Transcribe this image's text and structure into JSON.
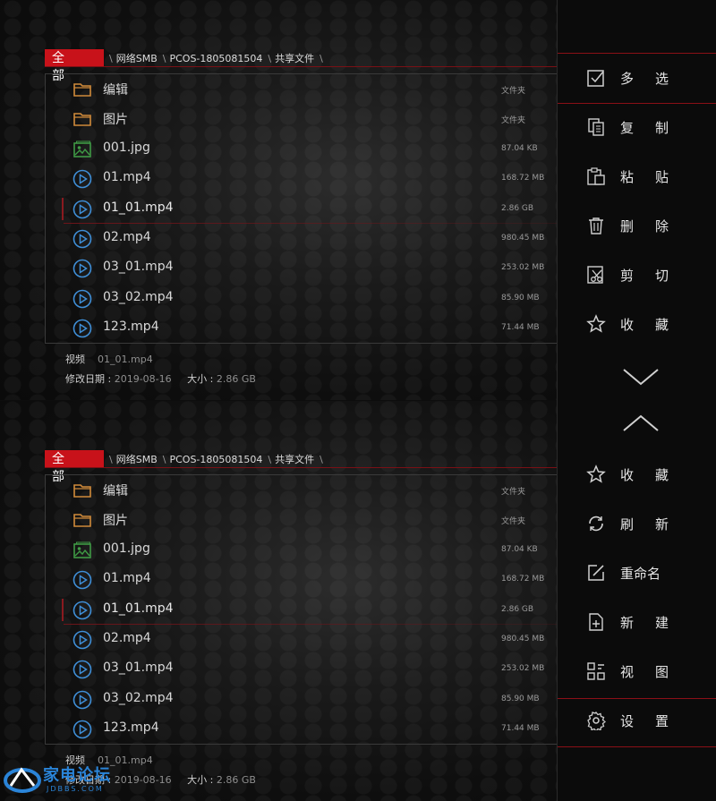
{
  "breadcrumb": {
    "root": "全部",
    "items": [
      "网络SMB",
      "PCOS-1805081504",
      "共享文件"
    ]
  },
  "files": [
    {
      "name": "编辑",
      "size": "文件夹",
      "icon": "folder-icon"
    },
    {
      "name": "图片",
      "size": "文件夹",
      "icon": "folder-icon"
    },
    {
      "name": "001.jpg",
      "size": "87.04 KB",
      "icon": "image-icon"
    },
    {
      "name": "01.mp4",
      "size": "168.72 MB",
      "icon": "play-icon"
    },
    {
      "name": "01_01.mp4",
      "size": "2.86 GB",
      "icon": "play-icon",
      "selected": true
    },
    {
      "name": "02.mp4",
      "size": "980.45 MB",
      "icon": "play-icon"
    },
    {
      "name": "03_01.mp4",
      "size": "253.02 MB",
      "icon": "play-icon"
    },
    {
      "name": "03_02.mp4",
      "size": "85.90 MB",
      "icon": "play-icon"
    },
    {
      "name": "123.mp4",
      "size": "71.44 MB",
      "icon": "play-icon"
    }
  ],
  "info": {
    "type_label": "视频",
    "type_value": "01_01.mp4",
    "date_label": "修改日期 :",
    "date_value": "2019-08-16",
    "size_label": "大小 :",
    "size_value": "2.86 GB"
  },
  "menu_top": [
    {
      "label": "多选",
      "icon": "checkbox-icon"
    },
    {
      "label": "复制",
      "icon": "copy-icon"
    },
    {
      "label": "粘贴",
      "icon": "paste-icon"
    },
    {
      "label": "删除",
      "icon": "trash-icon"
    },
    {
      "label": "剪切",
      "icon": "scissors-icon"
    },
    {
      "label": "收藏",
      "icon": "star-icon"
    }
  ],
  "menu_bottom": [
    {
      "label": "收藏",
      "icon": "star-icon"
    },
    {
      "label": "刷新",
      "icon": "refresh-icon"
    },
    {
      "label": "重命名",
      "icon": "rename-icon"
    },
    {
      "label": "新建",
      "icon": "new-file-icon"
    },
    {
      "label": "视图",
      "icon": "view-icon"
    },
    {
      "label": "设置",
      "icon": "gear-icon"
    }
  ],
  "watermark": {
    "text": "家电论坛",
    "sub": "JDBBS.COM"
  },
  "colors": {
    "accent": "#c8121a",
    "folder": "#d08a3a",
    "image": "#3f9a45",
    "video": "#3f8fd8"
  }
}
